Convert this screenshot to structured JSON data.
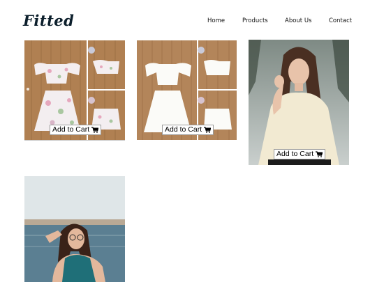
{
  "brand": {
    "name": "Fitted"
  },
  "nav": {
    "home": "Home",
    "products": "Products",
    "about": "About Us",
    "contact": "Contact"
  },
  "products": [
    {
      "button": "Add to Cart"
    },
    {
      "button": "Add to Cart"
    },
    {
      "button": "Add to Cart"
    }
  ],
  "icons": {
    "cart": "cart-icon"
  },
  "colors": {
    "brand": "#0c1f2c",
    "wood": "#a87a4d",
    "sweater": "#f2ead2",
    "sea": "#5b7f92",
    "top": "#1f6f78"
  }
}
